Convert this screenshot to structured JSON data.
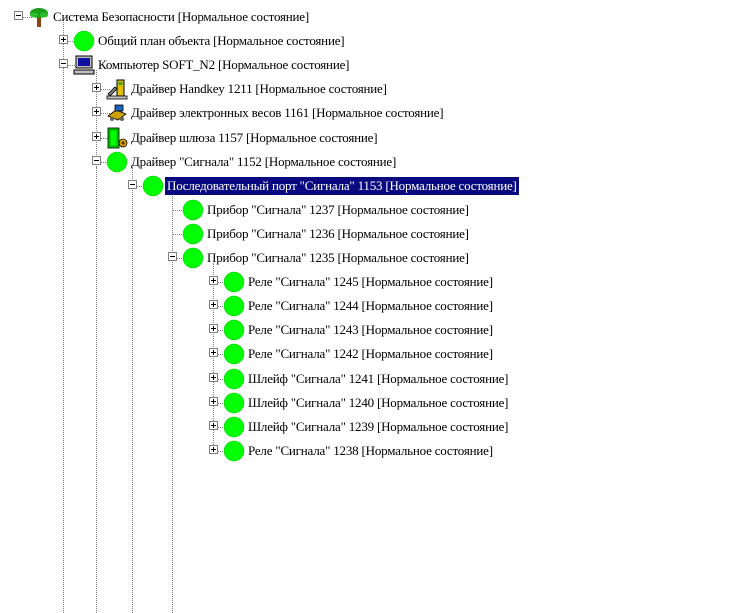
{
  "tree": {
    "nodes": [
      {
        "label": "Система Безопасности [Нормальное состояние]",
        "icon": "tree-icon",
        "level": 0,
        "expander": "minus"
      },
      {
        "label": "Общий план объекта [Нормальное состояние]",
        "icon": "green-status-icon",
        "level": 1,
        "expander": "plus"
      },
      {
        "label": "Компьютер SOFT_N2 [Нормальное состояние]",
        "icon": "computer-icon",
        "level": 1,
        "expander": "minus"
      },
      {
        "label": "Драйвер Handkey 1211 [Нормальное состояние]",
        "icon": "handkey-icon",
        "level": 2,
        "expander": "plus"
      },
      {
        "label": "Драйвер электронных весов 1161 [Нормальное состояние]",
        "icon": "scales-icon",
        "level": 2,
        "expander": "plus"
      },
      {
        "label": "Драйвер шлюза 1157 [Нормальное состояние]",
        "icon": "gateway-icon",
        "level": 2,
        "expander": "plus"
      },
      {
        "label": "Драйвер \"Сигнала\" 1152 [Нормальное состояние]",
        "icon": "green-status-icon",
        "level": 2,
        "expander": "minus"
      },
      {
        "label": "Последовательный порт \"Сигнала\" 1153 [Нормальное состояние]",
        "icon": "green-status-icon",
        "level": 3,
        "expander": "minus",
        "selected": true
      },
      {
        "label": "Прибор \"Сигнала\" 1237 [Нормальное состояние]",
        "icon": "green-status-icon",
        "level": 4,
        "expander": "none"
      },
      {
        "label": "Прибор \"Сигнала\" 1236 [Нормальное состояние]",
        "icon": "green-status-icon",
        "level": 4,
        "expander": "none"
      },
      {
        "label": "Прибор \"Сигнала\" 1235 [Нормальное состояние]",
        "icon": "green-status-icon",
        "level": 4,
        "expander": "minus"
      },
      {
        "label": "Реле \"Сигнала\" 1245 [Нормальное состояние]",
        "icon": "green-status-icon",
        "level": 5,
        "expander": "plus"
      },
      {
        "label": "Реле \"Сигнала\" 1244 [Нормальное состояние]",
        "icon": "green-status-icon",
        "level": 5,
        "expander": "plus"
      },
      {
        "label": "Реле \"Сигнала\" 1243 [Нормальное состояние]",
        "icon": "green-status-icon",
        "level": 5,
        "expander": "plus"
      },
      {
        "label": "Реле \"Сигнала\" 1242 [Нормальное состояние]",
        "icon": "green-status-icon",
        "level": 5,
        "expander": "plus"
      },
      {
        "label": "Шлейф \"Сигнала\" 1241 [Нормальное состояние]",
        "icon": "green-status-icon",
        "level": 5,
        "expander": "plus"
      },
      {
        "label": "Шлейф \"Сигнала\" 1240 [Нормальное состояние]",
        "icon": "green-status-icon",
        "level": 5,
        "expander": "plus"
      },
      {
        "label": "Шлейф \"Сигнала\" 1239 [Нормальное состояние]",
        "icon": "green-status-icon",
        "level": 5,
        "expander": "plus"
      },
      {
        "label": "Реле \"Сигнала\" 1238 [Нормальное состояние]",
        "icon": "green-status-icon",
        "level": 5,
        "expander": "plus"
      }
    ]
  },
  "colors": {
    "status_green": "#00ff00",
    "selection_bg": "#0a0a80",
    "selection_fg": "#ffffff",
    "tree_line": "#808080"
  }
}
